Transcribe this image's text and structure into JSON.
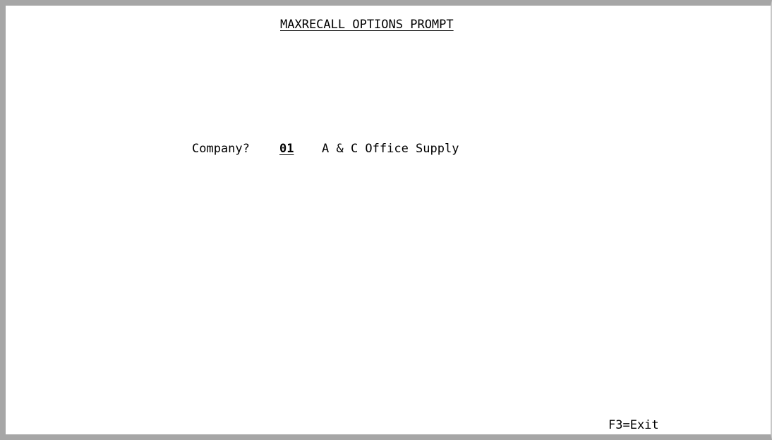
{
  "screen": {
    "title": "MAXRECALL OPTIONS PROMPT"
  },
  "prompt": {
    "label": "Company?",
    "value": "01",
    "company_name": "A & C Office Supply"
  },
  "function_keys": {
    "exit": "F3=Exit"
  }
}
